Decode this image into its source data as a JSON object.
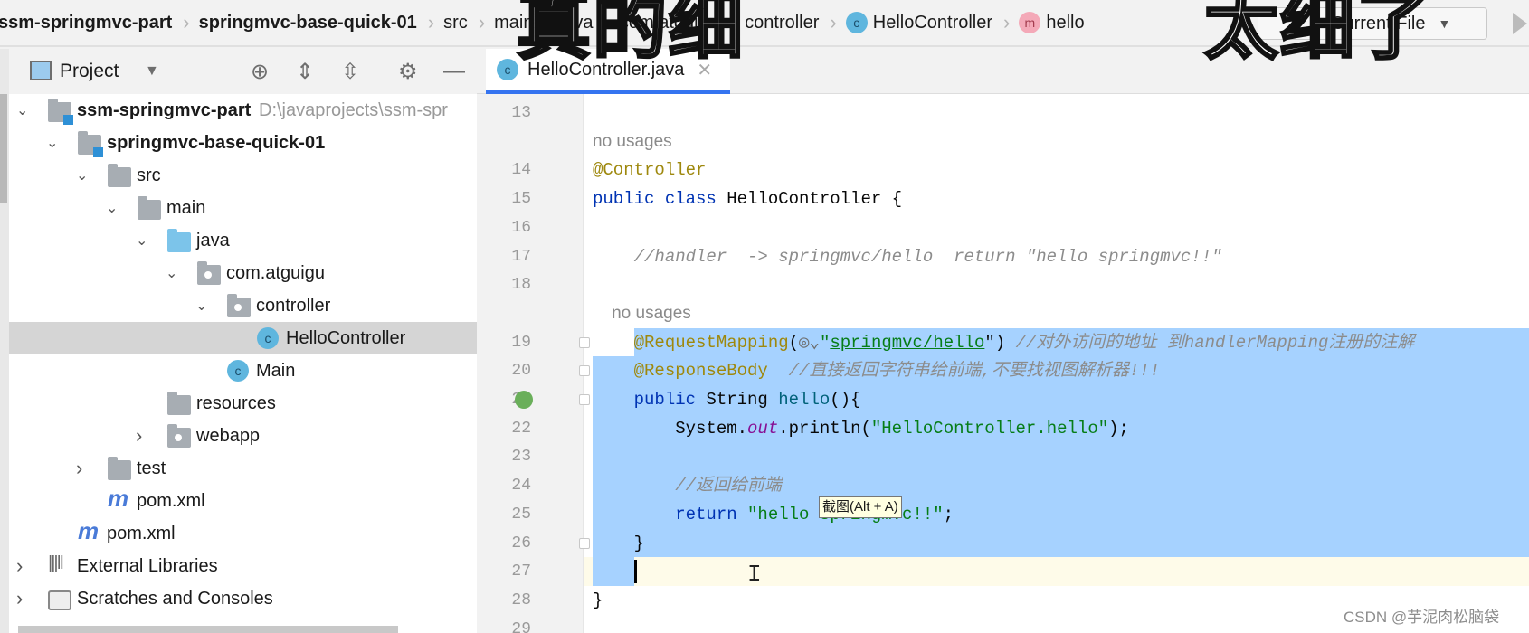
{
  "breadcrumbs": [
    {
      "label": "ssm-springmvc-part",
      "bold": true
    },
    {
      "label": "springmvc-base-quick-01",
      "bold": true
    },
    {
      "label": "src"
    },
    {
      "label": "main"
    },
    {
      "label": "java"
    },
    {
      "label": "com.atguigu"
    },
    {
      "label": "controller"
    },
    {
      "label": "HelloController",
      "icon": "class-icon"
    },
    {
      "label": "hello",
      "icon": "method-icon"
    }
  ],
  "run_config": {
    "label": "Current File"
  },
  "project_panel": {
    "title": "Project"
  },
  "tree": [
    {
      "label": "ssm-springmvc-part",
      "level": 0,
      "icon": "module",
      "expanded": true,
      "bold": true,
      "hint": "D:\\javaprojects\\ssm-spr"
    },
    {
      "label": "springmvc-base-quick-01",
      "level": 1,
      "icon": "module",
      "expanded": true,
      "bold": true
    },
    {
      "label": "src",
      "level": 2,
      "icon": "folder",
      "expanded": true
    },
    {
      "label": "main",
      "level": 3,
      "icon": "folder",
      "expanded": true
    },
    {
      "label": "java",
      "level": 4,
      "icon": "source-folder",
      "expanded": true
    },
    {
      "label": "com.atguigu",
      "level": 5,
      "icon": "package",
      "expanded": true
    },
    {
      "label": "controller",
      "level": 6,
      "icon": "package",
      "expanded": true
    },
    {
      "label": "HelloController",
      "level": 7,
      "icon": "class",
      "selected": true
    },
    {
      "label": "Main",
      "level": 6,
      "icon": "main-class"
    },
    {
      "label": "resources",
      "level": 4,
      "icon": "resources-folder"
    },
    {
      "label": "webapp",
      "level": 4,
      "icon": "web-folder",
      "expanded": false
    },
    {
      "label": "test",
      "level": 2,
      "icon": "folder",
      "expanded": false
    },
    {
      "label": "pom.xml",
      "level": 2,
      "icon": "maven"
    },
    {
      "label": "pom.xml",
      "level": 1,
      "icon": "maven"
    },
    {
      "label": "External Libraries",
      "level": 0,
      "icon": "libraries",
      "expanded": false
    },
    {
      "label": "Scratches and Consoles",
      "level": 0,
      "icon": "scratches",
      "expanded": false
    }
  ],
  "editor_tab": {
    "label": "HelloController.java"
  },
  "code_lines": [
    {
      "n": "13",
      "tokens": []
    },
    {
      "inlay": "no usages"
    },
    {
      "n": "14",
      "tokens": [
        {
          "t": "@Controller",
          "c": "#9e880d"
        }
      ]
    },
    {
      "n": "15",
      "tokens": [
        {
          "t": "public class ",
          "c": "#0033b3"
        },
        {
          "t": "HelloController {",
          "c": "#080808"
        }
      ]
    },
    {
      "n": "16",
      "tokens": []
    },
    {
      "n": "17",
      "tokens": [
        {
          "t": "    //handler  -> springmvc/hello  return \"hello springmvc!!\"",
          "c": "#8c8c8c",
          "i": true
        }
      ]
    },
    {
      "n": "18",
      "tokens": []
    },
    {
      "inlay": "    no usages"
    },
    {
      "n": "19",
      "tokens": [
        {
          "t": "    @RequestMapping",
          "c": "#9e880d"
        },
        {
          "t": "(",
          "c": "#080808"
        },
        {
          "t": "◎⌄",
          "c": "#6e6e6e"
        },
        {
          "t": "\"",
          "c": "#067d17"
        },
        {
          "t": "springmvc/hello",
          "c": "#067d17",
          "u": true
        },
        {
          "t": "\") ",
          "c": "#080808"
        },
        {
          "t": "//对外访问的地址 到handlerMapping注册的注解",
          "c": "#8c8c8c",
          "i": true
        }
      ]
    },
    {
      "n": "20",
      "tokens": [
        {
          "t": "    @ResponseBody",
          "c": "#9e880d"
        },
        {
          "t": "  //直接返回字符串给前端,不要找视图解析器!!!",
          "c": "#8c8c8c",
          "i": true
        }
      ]
    },
    {
      "n": "21",
      "tokens": [
        {
          "t": "    public ",
          "c": "#0033b3"
        },
        {
          "t": "String ",
          "c": "#080808"
        },
        {
          "t": "hello",
          "c": "#00627a"
        },
        {
          "t": "(){",
          "c": "#080808"
        }
      ]
    },
    {
      "n": "22",
      "tokens": [
        {
          "t": "        System.",
          "c": "#080808"
        },
        {
          "t": "out",
          "c": "#871094",
          "i": true
        },
        {
          "t": ".println(",
          "c": "#080808"
        },
        {
          "t": "\"HelloController.hello\"",
          "c": "#067d17"
        },
        {
          "t": ");",
          "c": "#080808"
        }
      ]
    },
    {
      "n": "23",
      "tokens": []
    },
    {
      "n": "24",
      "tokens": [
        {
          "t": "        //返回给前端",
          "c": "#8c8c8c",
          "i": true
        }
      ]
    },
    {
      "n": "25",
      "tokens": [
        {
          "t": "        return ",
          "c": "#0033b3"
        },
        {
          "t": "\"hello springmvc!!\"",
          "c": "#067d17"
        },
        {
          "t": ";",
          "c": "#080808"
        }
      ]
    },
    {
      "n": "26",
      "tokens": [
        {
          "t": "    }",
          "c": "#080808"
        }
      ]
    },
    {
      "n": "27",
      "tokens": []
    },
    {
      "n": "28",
      "tokens": [
        {
          "t": "}",
          "c": "#080808"
        }
      ]
    },
    {
      "n": "29",
      "tokens": []
    }
  ],
  "tooltip": {
    "text": "截图(Alt + A)"
  },
  "captions": {
    "left": "真的细",
    "right": "太细了"
  },
  "watermark": "CSDN @芋泥肉松脑袋",
  "colors": {
    "selection": "#a6d2ff",
    "accent": "#3574f0",
    "tree_selected": "#d5d5d5"
  }
}
